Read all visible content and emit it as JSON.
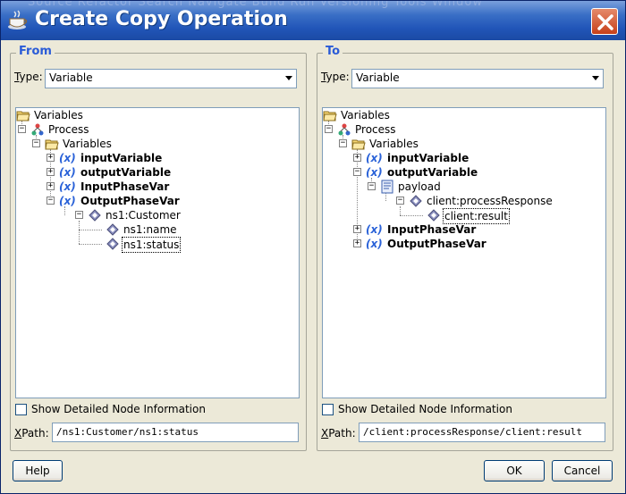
{
  "window": {
    "title": "Create Copy Operation",
    "ghost_text": "Source  Refactor  Search  Navigate  Build  Run  Versioning  Tools  Window"
  },
  "from": {
    "group_title": "From",
    "type_label": "Type:",
    "type_value": "Variable",
    "tree": [
      {
        "label": "Variables"
      },
      {
        "label": "Process"
      },
      {
        "label": "Variables"
      },
      {
        "label": "inputVariable"
      },
      {
        "label": "outputVariable"
      },
      {
        "label": "InputPhaseVar"
      },
      {
        "label": "OutputPhaseVar"
      },
      {
        "label": "ns1:Customer"
      },
      {
        "label": "ns1:name"
      },
      {
        "label": "ns1:status"
      }
    ],
    "show_detailed_label": "Show Detailed Node Information",
    "xpath_label": "XPath:",
    "xpath_value": "/ns1:Customer/ns1:status"
  },
  "to": {
    "group_title": "To",
    "type_label": "Type:",
    "type_value": "Variable",
    "tree": [
      {
        "label": "Variables"
      },
      {
        "label": "Process"
      },
      {
        "label": "Variables"
      },
      {
        "label": "inputVariable"
      },
      {
        "label": "outputVariable"
      },
      {
        "label": "payload"
      },
      {
        "label": "client:processResponse"
      },
      {
        "label": "client:result"
      },
      {
        "label": "InputPhaseVar"
      },
      {
        "label": "OutputPhaseVar"
      }
    ],
    "show_detailed_label": "Show Detailed Node Information",
    "xpath_label": "XPath:",
    "xpath_value": "/client:processResponse/client:result"
  },
  "buttons": {
    "help": "Help",
    "ok": "OK",
    "cancel": "Cancel"
  },
  "icons": {
    "folder": "folder-icon",
    "process": "process-icon",
    "variable": "variable-x-icon",
    "element": "element-diamond-icon",
    "payload": "payload-part-icon",
    "close": "close-icon",
    "app": "app-cup-icon"
  },
  "colors": {
    "title_bar": "#2155b8",
    "group_title": "#2a5bd7",
    "variable_icon": "#2a62d8"
  }
}
